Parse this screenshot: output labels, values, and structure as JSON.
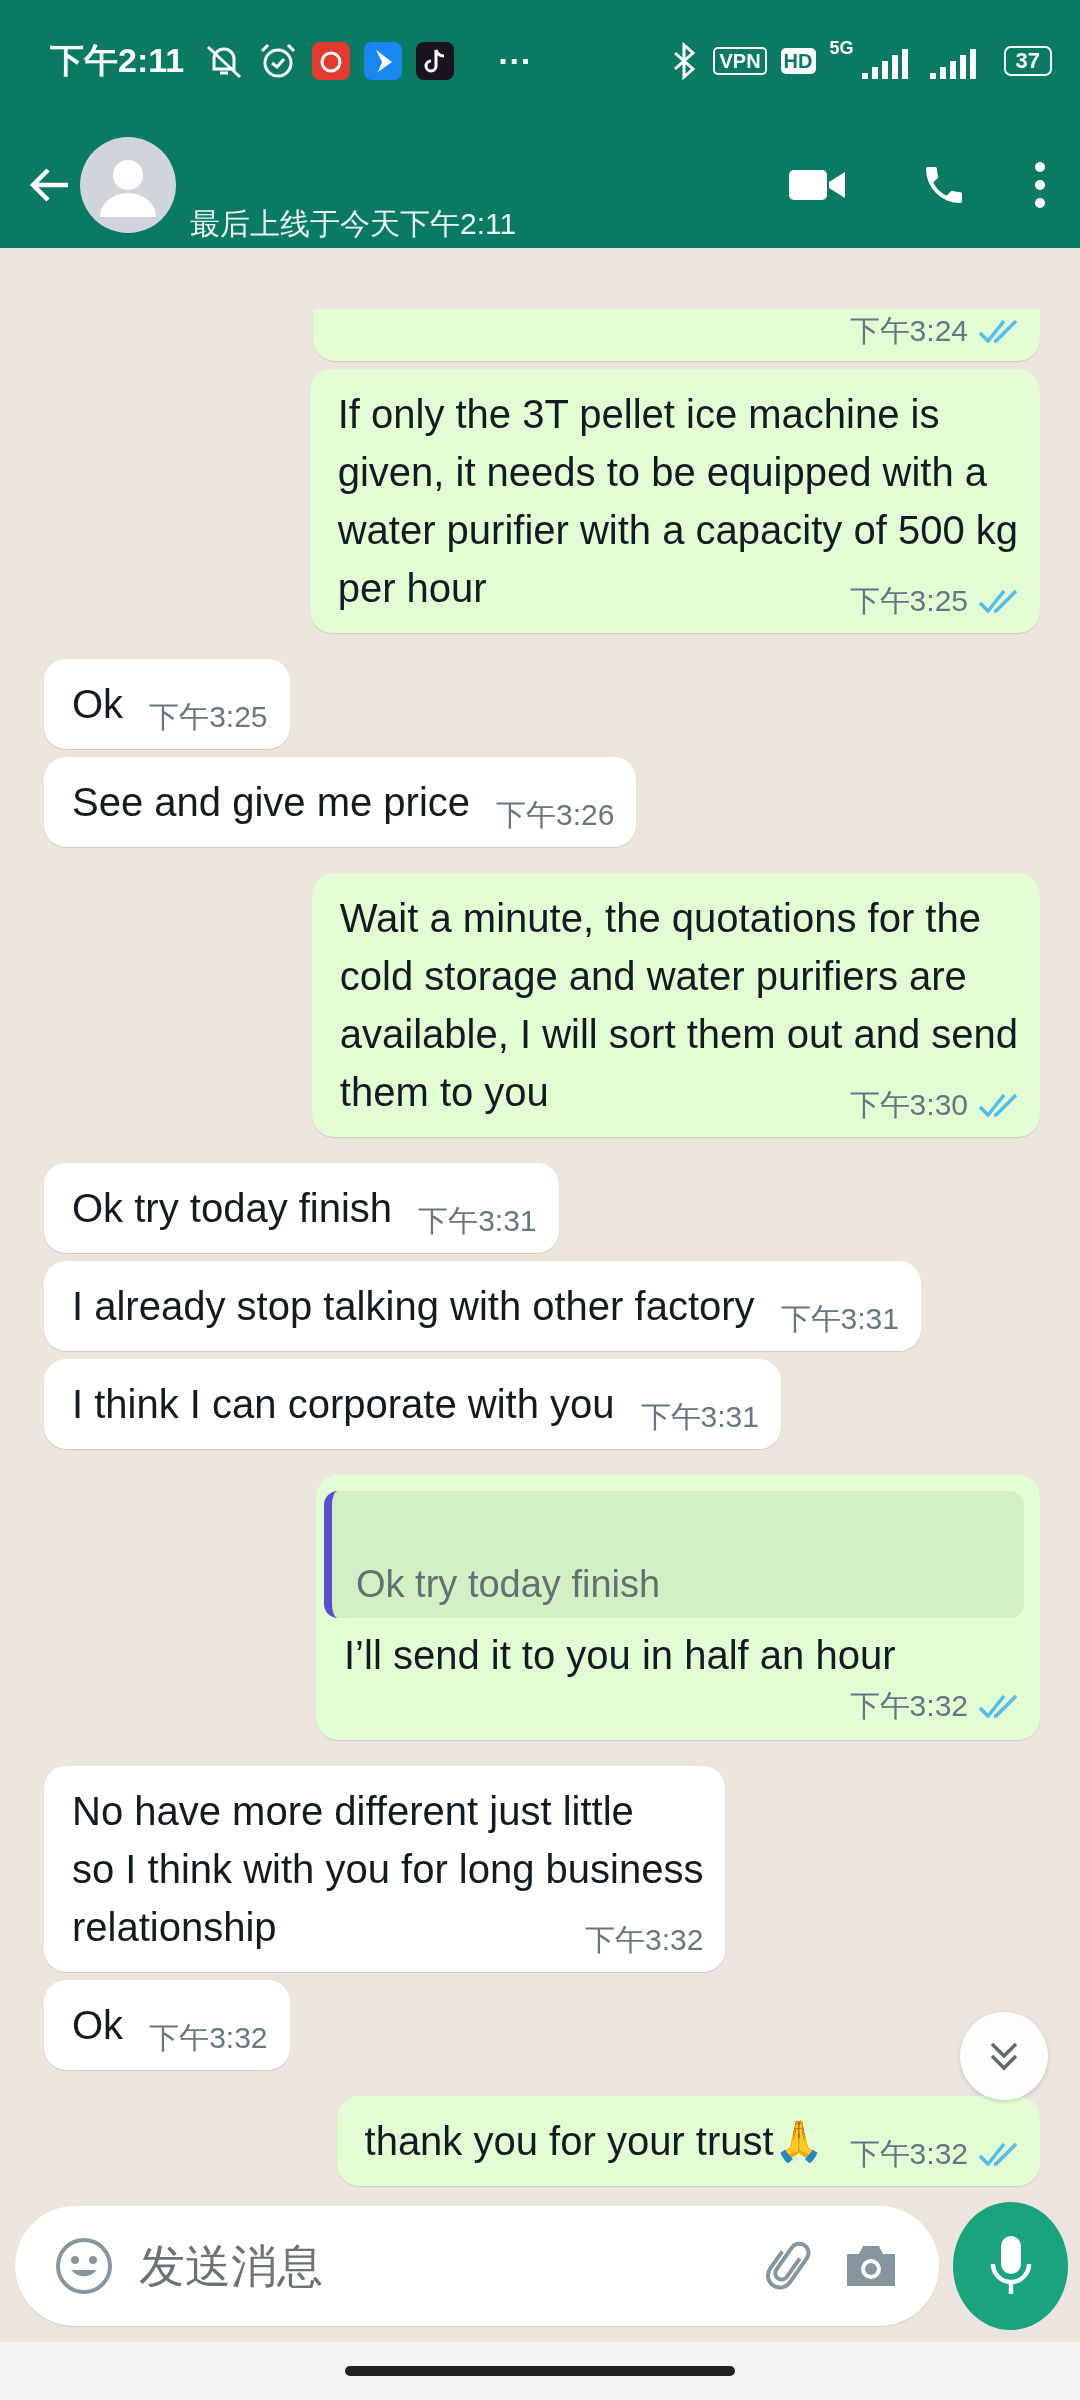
{
  "status_bar": {
    "time": "下午2:11",
    "more": "···",
    "vpn": "VPN",
    "hd": "HD",
    "network": "5G",
    "battery": "37"
  },
  "header": {
    "last_seen": "最后上线于今天下午2:11"
  },
  "messages": [
    {
      "kind": "out",
      "time": "下午3:24",
      "read": true
    },
    {
      "kind": "out",
      "text": "If only the 3T pellet ice machine is\ngiven, it needs to be equipped with a\nwater purifier with a capacity of 500 kg\nper hour",
      "time": "下午3:25",
      "read": true
    },
    {
      "kind": "in",
      "text": "Ok",
      "time": "下午3:25"
    },
    {
      "kind": "in",
      "text": "See and give me price",
      "time": "下午3:26"
    },
    {
      "kind": "out",
      "text": "Wait a minute, the quotations for the\ncold storage and water purifiers are\navailable, I will sort them out and send\nthem to you",
      "time": "下午3:30",
      "read": true
    },
    {
      "kind": "in",
      "text": "Ok try today finish",
      "time": "下午3:31"
    },
    {
      "kind": "in",
      "text": "I already stop talking with other factory",
      "time": "下午3:31"
    },
    {
      "kind": "in",
      "text": "I think I can corporate with you",
      "time": "下午3:31"
    },
    {
      "kind": "out",
      "quote": {
        "text": "Ok try today finish"
      },
      "text": "I’ll send it to you in half an hour",
      "time": "下午3:32",
      "read": true
    },
    {
      "kind": "in",
      "text": "No have more different just little\nso I think with you for long business\nrelationship",
      "time": "下午3:32"
    },
    {
      "kind": "in",
      "text": "Ok",
      "time": "下午3:32"
    },
    {
      "kind": "out",
      "text": "thank you for your trust🙏",
      "time": "下午3:32",
      "read": true
    }
  ],
  "composer": {
    "placeholder": "发送消息"
  }
}
